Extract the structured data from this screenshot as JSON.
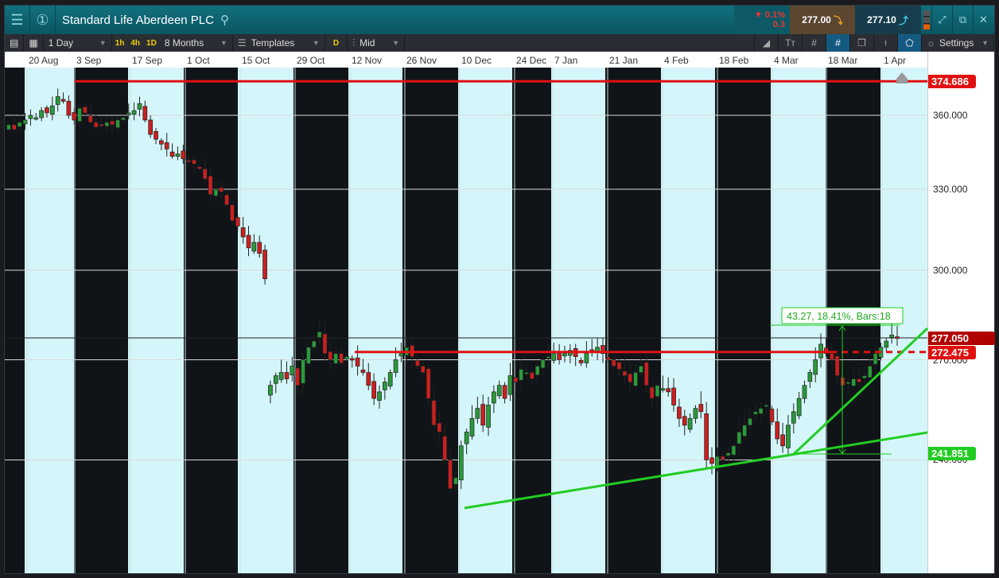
{
  "header": {
    "title": "Standard Life Aberdeen PLC",
    "change_pct": "0.1%",
    "change_abs": "0.3",
    "sell": "277.00",
    "buy": "277.10"
  },
  "toolbar": {
    "interval": "1 Day",
    "quick": [
      "1h",
      "4h",
      "1D"
    ],
    "range": "8 Months",
    "templates": "Templates",
    "d": "D",
    "price_type": "Mid",
    "settings": "Settings"
  },
  "dates": [
    "20 Aug",
    "3 Sep",
    "17 Sep",
    "1 Oct",
    "15 Oct",
    "29 Oct",
    "12 Nov",
    "26 Nov",
    "10 Dec",
    "24 Dec",
    "7 Jan",
    "21 Jan",
    "4 Feb",
    "18 Feb",
    "4 Mar",
    "18 Mar",
    "1 Apr"
  ],
  "price_ticks": [
    "360.000",
    "330.000",
    "300.000",
    "270.000",
    "240.000"
  ],
  "labels": {
    "resistance_high": "374.686",
    "resistance_mid": "272.475",
    "current": "277.050",
    "support": "241.851",
    "measure": "43.27, 18.41%, Bars:18"
  },
  "colors": {
    "up": "#2a9a3a",
    "down": "#cc1f1f",
    "red_line": "#e01010",
    "green_line": "#22cc22",
    "band": "#d4f6fa"
  },
  "chart_data": {
    "type": "candlestick",
    "scale": "log",
    "ylim": [
      222,
      382
    ],
    "closes": [
      356,
      354,
      357,
      358,
      360,
      359,
      362,
      361,
      364,
      368,
      366,
      360,
      358,
      363,
      361,
      357,
      355,
      356,
      357,
      356,
      358,
      359,
      361,
      362,
      365,
      358,
      352,
      350,
      348,
      346,
      343,
      344,
      342,
      341,
      340,
      338,
      334,
      328,
      330,
      329,
      324,
      318,
      316,
      312,
      308,
      310,
      306,
      297,
      262,
      265,
      266,
      264,
      268,
      262,
      270,
      274,
      276,
      279,
      272,
      270,
      272,
      269,
      271,
      270,
      268,
      266,
      262,
      258,
      260,
      263,
      266,
      270,
      272,
      274,
      271,
      268,
      266,
      258,
      250,
      248,
      240,
      232,
      235,
      244,
      248,
      252,
      255,
      250,
      256,
      260,
      262,
      258,
      265,
      263,
      267,
      266,
      264,
      268,
      270,
      271,
      272,
      270,
      272,
      273,
      271,
      269,
      272,
      273,
      274,
      272,
      270,
      268,
      267,
      265,
      263,
      266,
      268,
      262,
      258,
      262,
      261,
      260,
      256,
      252,
      250,
      252,
      255,
      254,
      240,
      239,
      241,
      240,
      242,
      244,
      248,
      250,
      252,
      254,
      255,
      256,
      251,
      246,
      244,
      250,
      254,
      258,
      262,
      266,
      270,
      275,
      272,
      270,
      265,
      262,
      263,
      264,
      263,
      265,
      268,
      272,
      274,
      276,
      278,
      277
    ]
  }
}
